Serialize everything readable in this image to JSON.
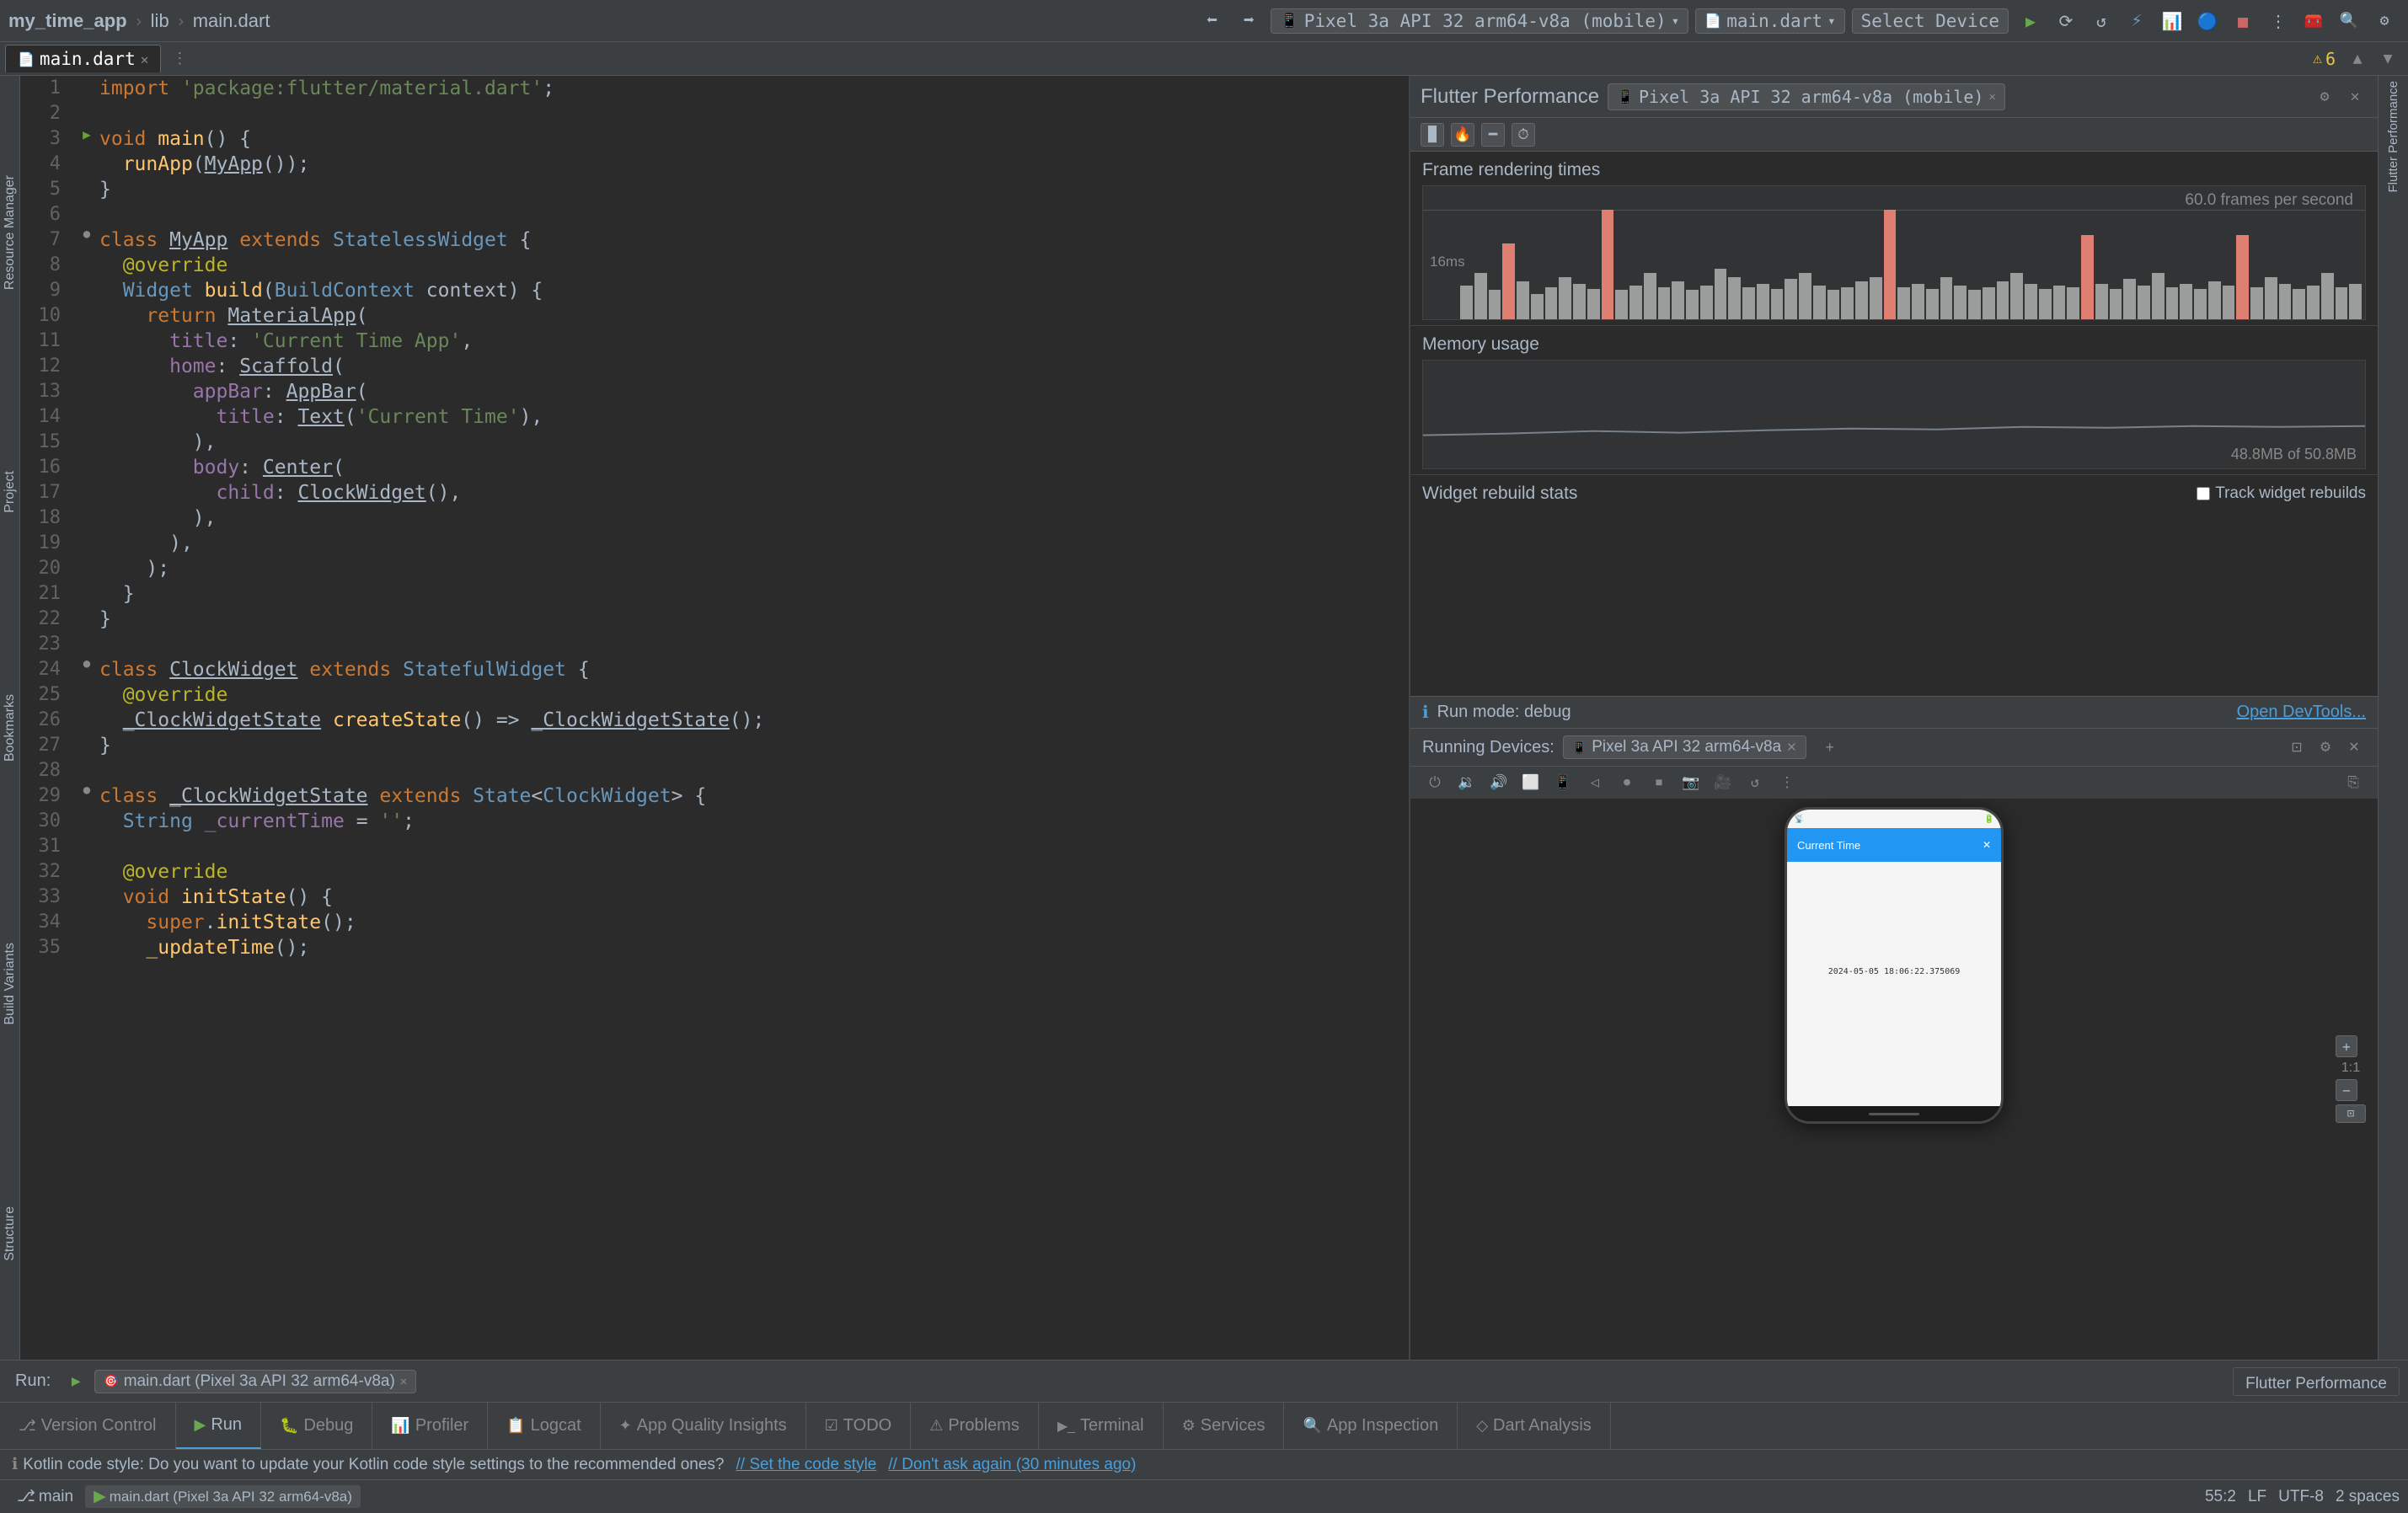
{
  "app": {
    "project_name": "my_time_app",
    "lib_label": "lib",
    "file_name": "main.dart"
  },
  "top_bar": {
    "device_selector": "Pixel 3a API 32 arm64-v8a (mobile)",
    "file_tab": "main.dart",
    "select_device": "Select Device",
    "run_btn": "▶",
    "stop_icon": "■",
    "debug_icon": "🐞"
  },
  "flutter_performance": {
    "title": "Flutter Performance",
    "device_tab": "Pixel 3a API 32 arm64-v8a (mobile)",
    "frame_rendering_title": "Frame rendering times",
    "fps_label": "60.0 frames per second",
    "ms_label": "16ms",
    "memory_title": "Memory usage",
    "memory_size": "48.8MB of 50.8MB",
    "widget_rebuild_title": "Widget rebuild stats",
    "track_checkbox_label": "Track widget rebuilds",
    "run_mode_label": "Run mode: debug",
    "open_devtools": "Open DevTools...",
    "running_devices_label": "Running Devices:",
    "running_device": "Pixel 3a API 32 arm64-v8a"
  },
  "phone_mockup": {
    "app_title": "Current Time",
    "time_display": "2024-05-05 18:06:22.375069"
  },
  "zoom": {
    "level": "1:1",
    "plus": "+",
    "minus": "−",
    "fit": "⊡"
  },
  "code_lines": [
    {
      "num": 1,
      "content": "import 'package:flutter/material.dart';",
      "gutter": ""
    },
    {
      "num": 2,
      "content": "",
      "gutter": ""
    },
    {
      "num": 3,
      "content": "void main() {",
      "gutter": "▶",
      "gutter_run": true
    },
    {
      "num": 4,
      "content": "  runApp(MyApp());",
      "gutter": ""
    },
    {
      "num": 5,
      "content": "}",
      "gutter": ""
    },
    {
      "num": 6,
      "content": "",
      "gutter": ""
    },
    {
      "num": 7,
      "content": "class MyApp extends StatelessWidget {",
      "gutter": "●"
    },
    {
      "num": 8,
      "content": "  @override",
      "gutter": ""
    },
    {
      "num": 9,
      "content": "  Widget build(BuildContext context) {",
      "gutter": ""
    },
    {
      "num": 10,
      "content": "    return MaterialApp(",
      "gutter": ""
    },
    {
      "num": 11,
      "content": "      title: 'Current Time App',",
      "gutter": ""
    },
    {
      "num": 12,
      "content": "      home: Scaffold(",
      "gutter": ""
    },
    {
      "num": 13,
      "content": "        appBar: AppBar(",
      "gutter": ""
    },
    {
      "num": 14,
      "content": "          title: Text('Current Time'),",
      "gutter": ""
    },
    {
      "num": 15,
      "content": "        ),",
      "gutter": ""
    },
    {
      "num": 16,
      "content": "        body: Center(",
      "gutter": ""
    },
    {
      "num": 17,
      "content": "          child: ClockWidget(),",
      "gutter": ""
    },
    {
      "num": 18,
      "content": "        ),",
      "gutter": ""
    },
    {
      "num": 19,
      "content": "      ),",
      "gutter": ""
    },
    {
      "num": 20,
      "content": "    );",
      "gutter": ""
    },
    {
      "num": 21,
      "content": "  }",
      "gutter": ""
    },
    {
      "num": 22,
      "content": "}",
      "gutter": ""
    },
    {
      "num": 23,
      "content": "",
      "gutter": ""
    },
    {
      "num": 24,
      "content": "class ClockWidget extends StatefulWidget {",
      "gutter": "●"
    },
    {
      "num": 25,
      "content": "  @override",
      "gutter": ""
    },
    {
      "num": 26,
      "content": "  _ClockWidgetState createState() => _ClockWidgetState();",
      "gutter": ""
    },
    {
      "num": 27,
      "content": "}",
      "gutter": ""
    },
    {
      "num": 28,
      "content": "",
      "gutter": ""
    },
    {
      "num": 29,
      "content": "class _ClockWidgetState extends State<ClockWidget> {",
      "gutter": "●"
    },
    {
      "num": 30,
      "content": "  String _currentTime = '';",
      "gutter": ""
    },
    {
      "num": 31,
      "content": "",
      "gutter": ""
    },
    {
      "num": 32,
      "content": "  @override",
      "gutter": ""
    },
    {
      "num": 33,
      "content": "  void initState() {",
      "gutter": ""
    },
    {
      "num": 34,
      "content": "    super.initState();",
      "gutter": ""
    },
    {
      "num": 35,
      "content": "    _updateTime();",
      "gutter": ""
    }
  ],
  "bottom_status": {
    "position": "55:2",
    "encoding": "UTF-8",
    "line_sep": "LF",
    "indent": "2 spaces"
  },
  "run_bar": {
    "run_label": "Run:",
    "task_label": "main.dart (Pixel 3a API 32 arm64-v8a)",
    "flutter_performance_label": "Flutter Performance"
  },
  "bottom_tabs": [
    {
      "id": "version-control",
      "label": "Version Control",
      "icon": "⎇"
    },
    {
      "id": "run",
      "label": "Run",
      "icon": "▶",
      "active": true
    },
    {
      "id": "debug",
      "label": "Debug",
      "icon": "🐛"
    },
    {
      "id": "profiler",
      "label": "Profiler",
      "icon": "📊"
    },
    {
      "id": "logcat",
      "label": "Logcat",
      "icon": "📋"
    },
    {
      "id": "app-quality",
      "label": "App Quality Insights",
      "icon": "✦"
    },
    {
      "id": "todo",
      "label": "TODO",
      "icon": "☑"
    },
    {
      "id": "problems",
      "label": "Problems",
      "icon": "⚠"
    },
    {
      "id": "terminal",
      "label": "Terminal",
      "icon": ">_"
    },
    {
      "id": "services",
      "label": "Services",
      "icon": "⚙"
    },
    {
      "id": "app-inspection",
      "label": "App Inspection",
      "icon": "🔍"
    },
    {
      "id": "dart-analysis",
      "label": "Dart Analysis",
      "icon": "◇"
    }
  ],
  "notification": {
    "text": "Kotlin code style: Do you want to update your Kotlin code style settings to the recommended ones?",
    "action1": "// Set the code style",
    "action2": "// Don't ask again (30 minutes ago)"
  },
  "right_sidebar_labels": [
    "Resource Manager",
    "Project",
    "Bookmarks",
    "Build Variants",
    "Structure"
  ],
  "bars": [
    {
      "height": 40,
      "high": false
    },
    {
      "height": 55,
      "high": false
    },
    {
      "height": 35,
      "high": false
    },
    {
      "height": 90,
      "high": true
    },
    {
      "height": 45,
      "high": false
    },
    {
      "height": 30,
      "high": false
    },
    {
      "height": 38,
      "high": false
    },
    {
      "height": 50,
      "high": false
    },
    {
      "height": 42,
      "high": false
    },
    {
      "height": 36,
      "high": false
    },
    {
      "height": 130,
      "high": true
    },
    {
      "height": 35,
      "high": false
    },
    {
      "height": 40,
      "high": false
    },
    {
      "height": 55,
      "high": false
    },
    {
      "height": 38,
      "high": false
    },
    {
      "height": 45,
      "high": false
    },
    {
      "height": 35,
      "high": false
    },
    {
      "height": 40,
      "high": false
    },
    {
      "height": 60,
      "high": false
    },
    {
      "height": 50,
      "high": false
    },
    {
      "height": 38,
      "high": false
    },
    {
      "height": 42,
      "high": false
    },
    {
      "height": 36,
      "high": false
    },
    {
      "height": 48,
      "high": false
    },
    {
      "height": 55,
      "high": false
    },
    {
      "height": 40,
      "high": false
    },
    {
      "height": 35,
      "high": false
    },
    {
      "height": 38,
      "high": false
    },
    {
      "height": 45,
      "high": false
    },
    {
      "height": 50,
      "high": false
    },
    {
      "height": 130,
      "high": true
    },
    {
      "height": 38,
      "high": false
    },
    {
      "height": 42,
      "high": false
    },
    {
      "height": 36,
      "high": false
    },
    {
      "height": 50,
      "high": false
    },
    {
      "height": 40,
      "high": false
    },
    {
      "height": 35,
      "high": false
    },
    {
      "height": 38,
      "high": false
    },
    {
      "height": 45,
      "high": false
    },
    {
      "height": 55,
      "high": false
    },
    {
      "height": 42,
      "high": false
    },
    {
      "height": 36,
      "high": false
    },
    {
      "height": 40,
      "high": false
    },
    {
      "height": 38,
      "high": false
    },
    {
      "height": 100,
      "high": true
    },
    {
      "height": 42,
      "high": false
    },
    {
      "height": 36,
      "high": false
    },
    {
      "height": 48,
      "high": false
    },
    {
      "height": 40,
      "high": false
    },
    {
      "height": 55,
      "high": false
    },
    {
      "height": 38,
      "high": false
    },
    {
      "height": 42,
      "high": false
    },
    {
      "height": 36,
      "high": false
    },
    {
      "height": 45,
      "high": false
    },
    {
      "height": 40,
      "high": false
    },
    {
      "height": 100,
      "high": true
    },
    {
      "height": 38,
      "high": false
    },
    {
      "height": 50,
      "high": false
    },
    {
      "height": 42,
      "high": false
    },
    {
      "height": 36,
      "high": false
    },
    {
      "height": 40,
      "high": false
    },
    {
      "height": 55,
      "high": false
    },
    {
      "height": 38,
      "high": false
    },
    {
      "height": 42,
      "high": false
    }
  ]
}
